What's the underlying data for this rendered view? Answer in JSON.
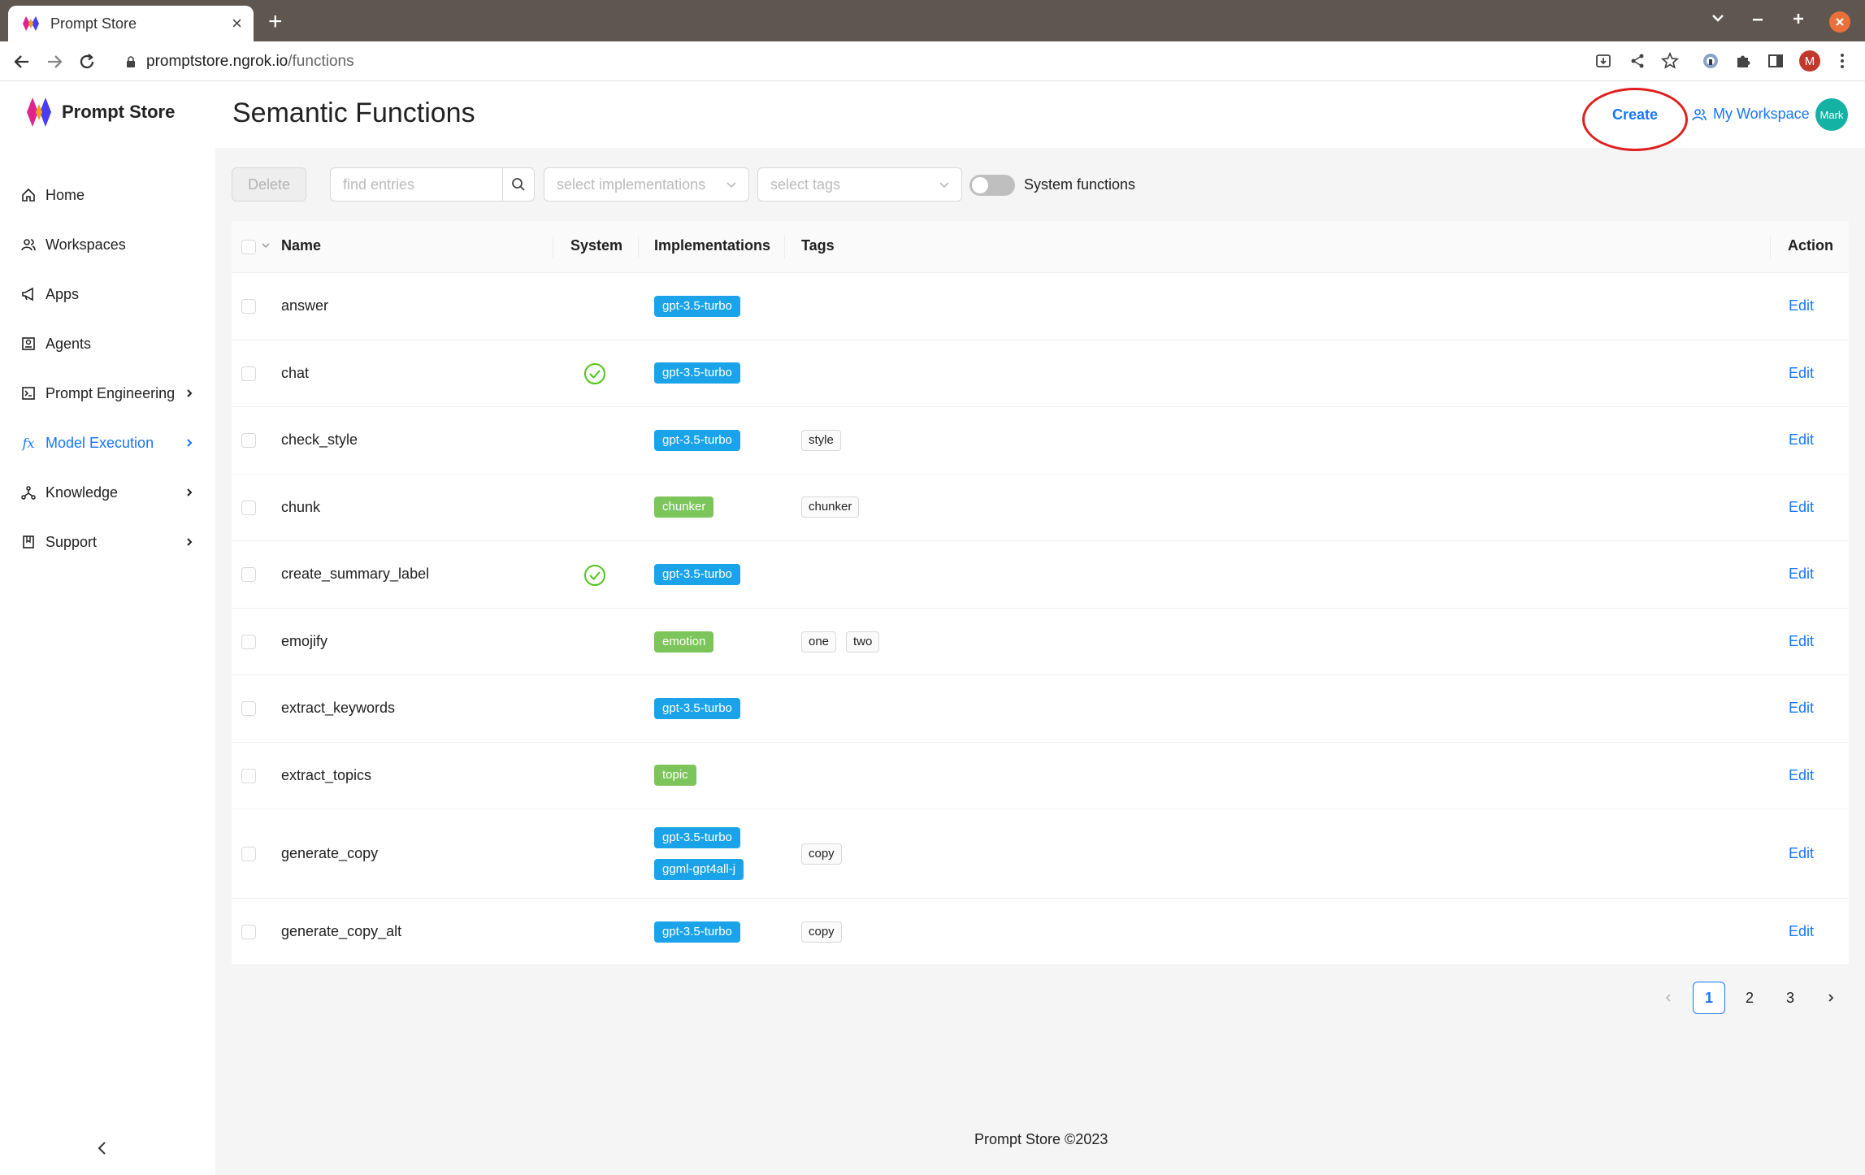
{
  "browser": {
    "tab_title": "Prompt Store",
    "url_host": "promptstore.ngrok.io",
    "url_path": "/functions",
    "profile_initial": "M"
  },
  "app": {
    "name": "Prompt Store",
    "accent": "#1677ff"
  },
  "sidebar": {
    "items": [
      {
        "label": "Home",
        "icon": "home-icon"
      },
      {
        "label": "Workspaces",
        "icon": "people-icon"
      },
      {
        "label": "Apps",
        "icon": "megaphone-icon"
      },
      {
        "label": "Agents",
        "icon": "agent-icon"
      },
      {
        "label": "Prompt Engineering",
        "icon": "terminal-icon"
      },
      {
        "label": "Model Execution",
        "icon": "fx-icon"
      },
      {
        "label": "Knowledge",
        "icon": "graph-icon"
      },
      {
        "label": "Support",
        "icon": "book-icon"
      }
    ]
  },
  "header": {
    "title": "Semantic Functions",
    "create_label": "Create",
    "workspace_label": "My Workspace",
    "avatar_text": "Mark"
  },
  "toolbar": {
    "delete_label": "Delete",
    "search_placeholder": "find entries",
    "implementations_placeholder": "select implementations",
    "tags_placeholder": "select tags",
    "toggle_label": "System functions"
  },
  "table": {
    "columns": {
      "name": "Name",
      "system": "System",
      "implementations": "Implementations",
      "tags": "Tags",
      "action": "Action"
    },
    "action_label": "Edit",
    "rows": [
      {
        "name": "answer",
        "system": false,
        "implementations": [
          "gpt-3.5-turbo"
        ],
        "tags": []
      },
      {
        "name": "chat",
        "system": true,
        "implementations": [
          "gpt-3.5-turbo"
        ],
        "tags": []
      },
      {
        "name": "check_style",
        "system": false,
        "implementations": [
          "gpt-3.5-turbo"
        ],
        "tags": [
          "style"
        ]
      },
      {
        "name": "chunk",
        "system": false,
        "implementations": [
          "chunker"
        ],
        "tags": [
          "chunker"
        ]
      },
      {
        "name": "create_summary_label",
        "system": true,
        "implementations": [
          "gpt-3.5-turbo"
        ],
        "tags": []
      },
      {
        "name": "emojify",
        "system": false,
        "implementations": [
          "emotion"
        ],
        "tags": [
          "one",
          "two"
        ]
      },
      {
        "name": "extract_keywords",
        "system": false,
        "implementations": [
          "gpt-3.5-turbo"
        ],
        "tags": []
      },
      {
        "name": "extract_topics",
        "system": false,
        "implementations": [
          "topic"
        ],
        "tags": []
      },
      {
        "name": "generate_copy",
        "system": false,
        "implementations": [
          "gpt-3.5-turbo",
          "ggml-gpt4all-j"
        ],
        "tags": [
          "copy"
        ]
      },
      {
        "name": "generate_copy_alt",
        "system": false,
        "implementations": [
          "gpt-3.5-turbo"
        ],
        "tags": [
          "copy"
        ]
      }
    ]
  },
  "pagination": {
    "pages": [
      "1",
      "2",
      "3"
    ],
    "current": "1"
  },
  "footer": {
    "text": "Prompt Store ©2023"
  }
}
